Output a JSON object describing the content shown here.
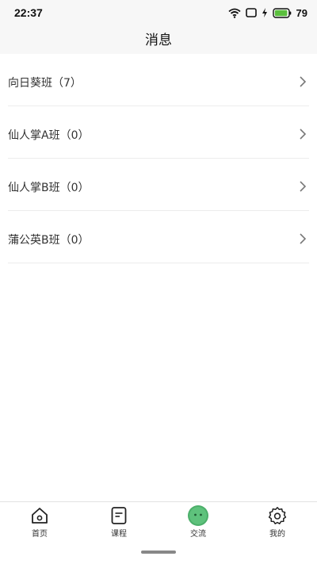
{
  "status_bar": {
    "time": "22:37",
    "battery_level": "79",
    "icons": [
      "wifi-icon",
      "sim-card-icon",
      "charging-icon",
      "battery-icon"
    ],
    "battery_color": "#5bbf3e"
  },
  "header": {
    "title": "消息"
  },
  "groups": [
    {
      "label": "向日葵班（7）"
    },
    {
      "label": "仙人掌A班（0）"
    },
    {
      "label": "仙人掌B班（0）"
    },
    {
      "label": "蒲公英B班（0）"
    }
  ],
  "tabbar": {
    "accent_color": "#4caf6a",
    "tabs": [
      {
        "label": "首页",
        "icon": "home-icon"
      },
      {
        "label": "课程",
        "icon": "notebook-icon"
      },
      {
        "label": "交流",
        "icon": "chat-bubble-icon",
        "active": true
      },
      {
        "label": "我的",
        "icon": "gear-icon"
      }
    ]
  }
}
